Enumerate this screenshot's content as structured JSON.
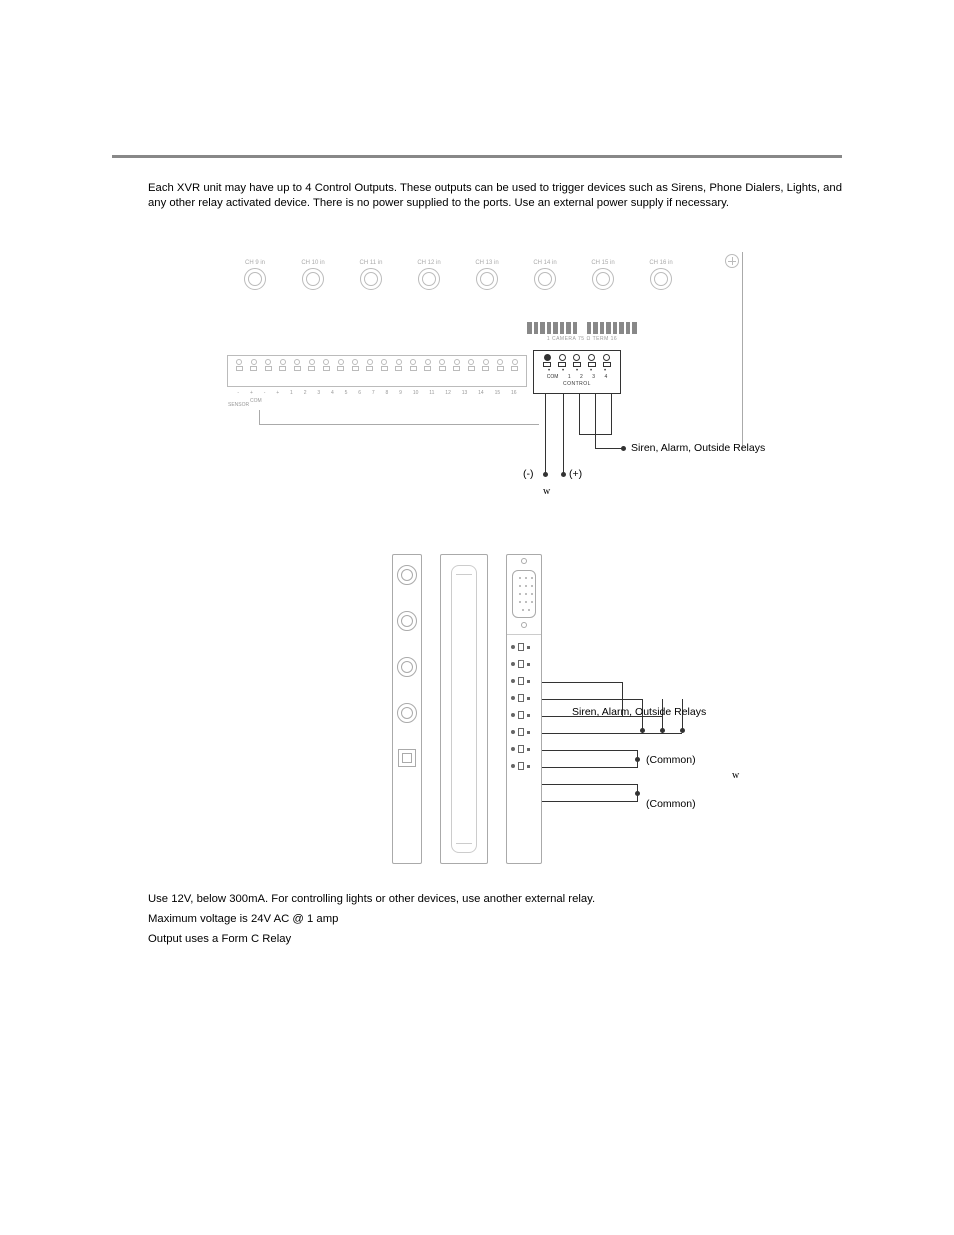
{
  "intro": "Each XVR unit may have up to 4 Control Outputs. These outputs can be used to trigger devices such as Sirens, Phone Dialers, Lights, and any other relay activated device.  There is no power supplied to the ports. Use an external power supply if necessary.",
  "fig1": {
    "bnc_labels": [
      "CH 9 in",
      "CH 10 in",
      "CH 11 in",
      "CH 12 in",
      "CH 13 in",
      "CH 14 in",
      "CH 15 in",
      "CH 16 in"
    ],
    "dip_label": "1  CAMERA  75 Ω    TERM  16",
    "sensor_numbers": [
      "1",
      "2",
      "3",
      "4",
      "5",
      "6",
      "7",
      "8",
      "9",
      "10",
      "11",
      "12",
      "13",
      "14",
      "15",
      "16"
    ],
    "sensor_sub": "SENSOR",
    "com_sub": "COM",
    "control_numbers": [
      "1",
      "2",
      "3",
      "4"
    ],
    "control_com": "COM",
    "control_label": "CONTROL",
    "minus": "(-)",
    "plus": "(+)",
    "relay_label": "Siren, Alarm, Outside Relays",
    "w": "w"
  },
  "fig2": {
    "relay_label": "Siren, Alarm, Outside Relays",
    "common": "(Common)",
    "w": "w"
  },
  "notes": {
    "l1": "Use 12V, below 300mA. For controlling lights or other devices, use another external relay.",
    "l2": "Maximum voltage is 24V AC @ 1 amp",
    "l3": "Output uses a Form C Relay"
  }
}
